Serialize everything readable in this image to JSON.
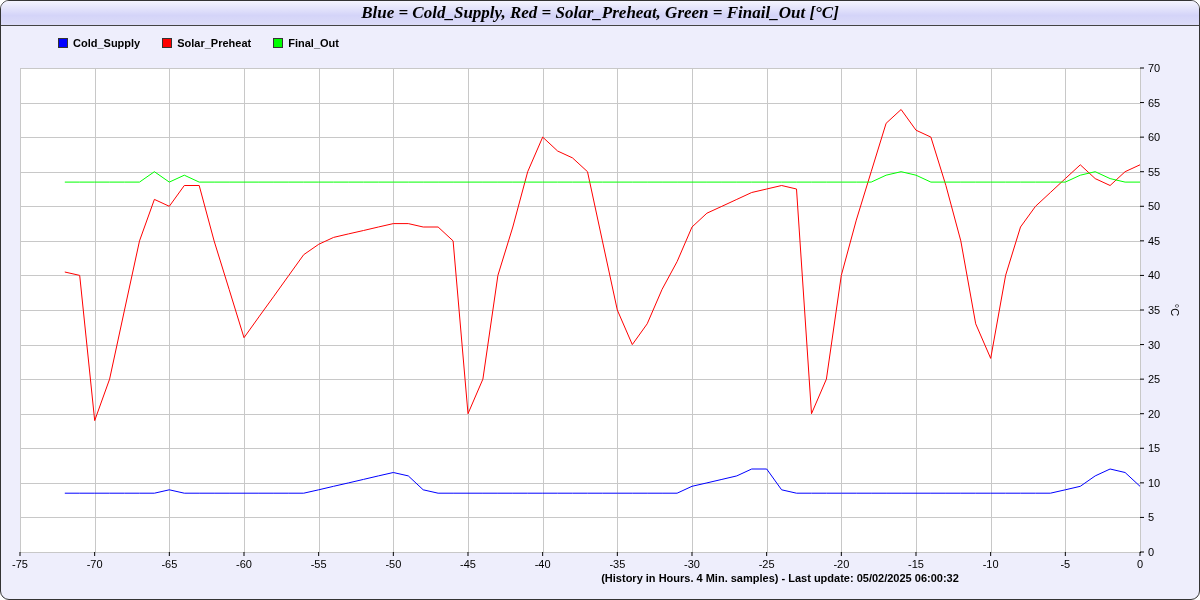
{
  "window": {
    "title": "Blue = Cold_Supply, Red = Solar_Preheat, Green = Finail_Out [°C]"
  },
  "chart": {
    "chart_data": {
      "type": "line",
      "xlabel": "(History in Hours. 4 Min. samples) - Last update: 05/02/2025 06:00:32",
      "ylabel": "°C",
      "x": [
        -72,
        -71,
        -70,
        -69,
        -68,
        -67,
        -66,
        -65,
        -64,
        -63,
        -62,
        -61,
        -60,
        -59,
        -58,
        -57,
        -56,
        -55,
        -54,
        -53,
        -52,
        -51,
        -50,
        -49,
        -48,
        -47,
        -46,
        -45,
        -44,
        -43,
        -42,
        -41,
        -40,
        -39,
        -38,
        -37,
        -36,
        -35,
        -34,
        -33,
        -32,
        -31,
        -30,
        -29,
        -28,
        -27,
        -26,
        -25,
        -24,
        -23,
        -22,
        -21,
        -20,
        -19,
        -18,
        -17,
        -16,
        -15,
        -14,
        -13,
        -12,
        -11,
        -10,
        -9,
        -8,
        -7,
        -6,
        -5,
        -4,
        -3,
        -2,
        -1,
        0
      ],
      "series": [
        {
          "name": "Cold_Supply",
          "color": "#0000ff",
          "values": [
            8.5,
            8.5,
            8.5,
            8.5,
            8.5,
            8.5,
            8.5,
            9,
            8.5,
            8.5,
            8.5,
            8.5,
            8.5,
            8.5,
            8.5,
            8.5,
            8.5,
            9,
            9.5,
            10,
            10.5,
            11,
            11.5,
            11,
            9,
            8.5,
            8.5,
            8.5,
            8.5,
            8.5,
            8.5,
            8.5,
            8.5,
            8.5,
            8.5,
            8.5,
            8.5,
            8.5,
            8.5,
            8.5,
            8.5,
            8.5,
            9.5,
            10,
            10.5,
            11,
            12,
            12,
            9,
            8.5,
            8.5,
            8.5,
            8.5,
            8.5,
            8.5,
            8.5,
            8.5,
            8.5,
            8.5,
            8.5,
            8.5,
            8.5,
            8.5,
            8.5,
            8.5,
            8.5,
            8.5,
            9,
            9.5,
            11,
            12,
            11.5,
            9.5
          ]
        },
        {
          "name": "Solar_Preheat",
          "color": "#ff0000",
          "values": [
            40.5,
            40,
            19,
            25,
            35,
            45,
            51,
            50,
            53,
            53,
            45,
            38,
            31,
            34,
            37,
            40,
            43,
            44.5,
            45.5,
            46,
            46.5,
            47,
            47.5,
            47.5,
            47,
            47,
            45,
            20,
            25,
            40,
            47,
            55,
            60,
            58,
            57,
            55,
            45,
            35,
            30,
            33,
            38,
            42,
            47,
            49,
            50,
            51,
            52,
            52.5,
            53,
            52.5,
            20,
            25,
            40,
            48,
            55,
            62,
            64,
            61,
            60,
            53,
            45,
            33,
            28,
            40,
            47,
            50,
            52,
            54,
            56,
            54,
            53,
            55,
            56
          ]
        },
        {
          "name": "Final_Out",
          "color": "#00ff00",
          "values": [
            53.5,
            53.5,
            53.5,
            53.5,
            53.5,
            53.5,
            55,
            53.5,
            54.5,
            53.5,
            53.5,
            53.5,
            53.5,
            53.5,
            53.5,
            53.5,
            53.5,
            53.5,
            53.5,
            53.5,
            53.5,
            53.5,
            53.5,
            53.5,
            53.5,
            53.5,
            53.5,
            53.5,
            53.5,
            53.5,
            53.5,
            53.5,
            53.5,
            53.5,
            53.5,
            53.5,
            53.5,
            53.5,
            53.5,
            53.5,
            53.5,
            53.5,
            53.5,
            53.5,
            53.5,
            53.5,
            53.5,
            53.5,
            53.5,
            53.5,
            53.5,
            53.5,
            53.5,
            53.5,
            53.5,
            54.5,
            55,
            54.5,
            53.5,
            53.5,
            53.5,
            53.5,
            53.5,
            53.5,
            53.5,
            53.5,
            53.5,
            53.5,
            54.5,
            55,
            54,
            53.5,
            53.5
          ]
        }
      ],
      "grid": true,
      "xlim": [
        -75,
        0
      ],
      "ylim": [
        0,
        70
      ],
      "xticks": [
        -75,
        -70,
        -65,
        -60,
        -55,
        -50,
        -45,
        -40,
        -35,
        -30,
        -25,
        -20,
        -15,
        -10,
        -5,
        0
      ],
      "yticks": [
        0,
        5,
        10,
        15,
        20,
        25,
        30,
        35,
        40,
        45,
        50,
        55,
        60,
        65,
        70
      ]
    }
  }
}
